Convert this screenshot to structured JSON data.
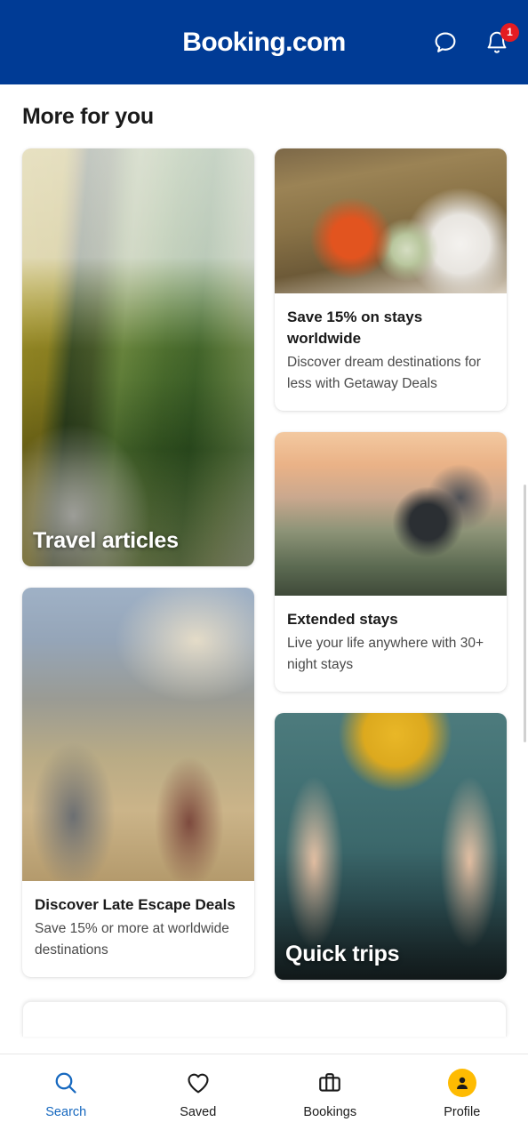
{
  "header": {
    "brand": "Booking.com",
    "chat_icon": "chat-bubble-icon",
    "bell_icon": "bell-icon",
    "notification_count": "1",
    "background_color": "#003b95",
    "badge_color": "#e41c22"
  },
  "main": {
    "section_title": "More for you",
    "cards": [
      {
        "id": "travel-articles",
        "style": "hero",
        "title": "Travel articles",
        "subtitle": "",
        "image_alt": "yellow camper van on a forest road"
      },
      {
        "id": "getaway-deals",
        "style": "text",
        "title": "Save 15% on stays worldwide",
        "subtitle": "Discover dream destinations for less with Getaway Deals",
        "image_alt": "family relaxing on folding chairs by a rock face"
      },
      {
        "id": "extended-stays",
        "style": "text",
        "title": "Extended stays",
        "subtitle": "Live your life anywhere with 30+ night stays",
        "image_alt": "woman with laptop on a balcony at sunset"
      },
      {
        "id": "late-escape-deals",
        "style": "text",
        "title": "Discover Late Escape Deals",
        "subtitle": "Save 15% or more at worldwide destinations",
        "image_alt": "group of hikers walking a mountain trail"
      },
      {
        "id": "quick-trips",
        "style": "hero",
        "title": "Quick trips",
        "subtitle": "",
        "image_alt": "person fastening a bag strap"
      }
    ]
  },
  "bottom_nav": {
    "active_color": "#1668bf",
    "avatar_color": "#febb02",
    "items": [
      {
        "label": "Search",
        "icon": "search-icon",
        "active": true
      },
      {
        "label": "Saved",
        "icon": "heart-icon",
        "active": false
      },
      {
        "label": "Bookings",
        "icon": "suitcase-icon",
        "active": false
      },
      {
        "label": "Profile",
        "icon": "avatar-icon",
        "active": false
      }
    ]
  }
}
